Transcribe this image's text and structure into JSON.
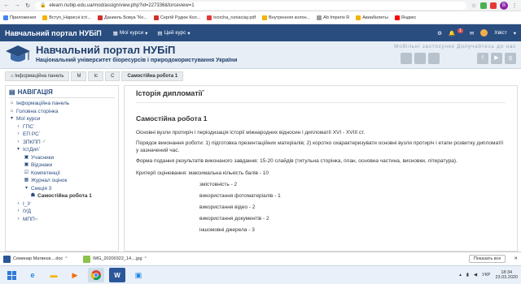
{
  "browser": {
    "url": "elearn.nubip.edu.ua/mod/assign/view.php?id=227336&forceview=1",
    "bookmarks": [
      "Приложения",
      "Вступ_Нарисні істі...",
      "Даниель Бовуа \"Ко...",
      "Сергій Рудюк Кол...",
      "tvorcha_runiaciay.pdf",
      "Внутренняя колон...",
      "Ab Imperio R",
      "Авиабилеты",
      "Яндекс"
    ]
  },
  "topnav": {
    "brand": "Навчальний портал НУБіП",
    "my_courses": "Мої курси",
    "this_course": "Цей курс",
    "notifications_count": "1",
    "user_name": "Хвіст"
  },
  "header": {
    "title": "Навчальний портал НУБіП",
    "subtitle": "Національний університет біоресурсів і природокористування України",
    "mobile_note": "Мобільні застосунки Долучайтесь до нас"
  },
  "breadcrumbs": [
    "Інформаційна панель",
    "М",
    "Іс",
    "С",
    "Самостійна робота 1"
  ],
  "sidebar": {
    "heading": "НАВІГАЦІЯ",
    "items": [
      {
        "label": "Інформаційна панель",
        "icon": "house-icon"
      },
      {
        "label": "Головна сторінка",
        "icon": "home-icon"
      },
      {
        "label": "Мої курси",
        "icon": "courses-icon"
      },
      {
        "label": "ГПС`",
        "icon": "folder-icon"
      },
      {
        "label": "ЕП РС`",
        "icon": "folder-icon"
      },
      {
        "label": "ЗПКПП",
        "icon": "folder-icon",
        "check": "✓"
      },
      {
        "label": "ІстДип`",
        "icon": "folder-icon"
      },
      {
        "label": "Учасники",
        "icon": "users-icon"
      },
      {
        "label": "Відзнаки",
        "icon": "badge-icon"
      },
      {
        "label": "Компетенції",
        "icon": "check-icon"
      },
      {
        "label": "Журнал оцінок",
        "icon": "table-icon"
      },
      {
        "label": "Секція 3",
        "icon": "folder-icon"
      },
      {
        "label": "Самостійна робота 1",
        "icon": "assignment-icon"
      },
      {
        "label": "І_У",
        "icon": "folder-icon"
      },
      {
        "label": "ІУД",
        "icon": "folder-icon"
      },
      {
        "label": "МПП~",
        "icon": "folder-icon"
      }
    ]
  },
  "main": {
    "page_title": "Історія дипломатії`",
    "assignment_title": "Самостійна робота 1",
    "paragraphs": [
      "Основні вузли протиріч і періодизація історії міжнародних відносин і дипломатії XVI - XVIII ст.",
      "Порядок виконання роботи: 1) підготовка презентаційних матеріалів; 2) коротко охарактеризувати основні вузли протиріч і етапи розвитку дипломатії у зазначений час.",
      "Форма подання результатів виконаного завдання: 15-20 слайдів (титульна сторінка, план, основна частина, висновки, література)."
    ],
    "criteria_intro": "Критерії оцінювання: максимальна кількість балів - 10",
    "criteria": [
      "змістовність - 2",
      "використання фотоматеріалів - 1",
      "використання відео - 2",
      "використання документів - 2",
      "іншомовні джерела - 3"
    ]
  },
  "downloads": {
    "items": [
      {
        "name": "Семинар Матвеєв....doc",
        "color": "#2b579a"
      },
      {
        "name": "IMG_20200322_14....jpg",
        "color": "#8bc34a"
      }
    ],
    "show_all": "Показать все"
  },
  "taskbar": {
    "lang": "УКР",
    "time": "18:34",
    "date": "23.03.2020"
  }
}
